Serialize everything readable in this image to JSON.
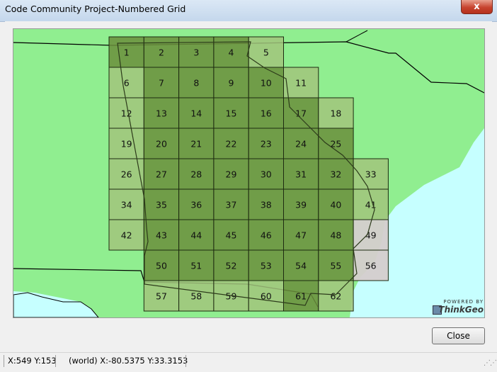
{
  "window": {
    "title": "Code Community Project-Numbered Grid",
    "close_glyph": "x"
  },
  "map": {
    "land_color": "#90ee90",
    "water_color": "#c6ffff",
    "cell_light_color": "#a2c47c",
    "cell_dark_color": "#6b8e3c",
    "cell_gray_color": "#d5cdcd",
    "grid_cells": [
      {
        "n": "1",
        "c": 0,
        "r": 0,
        "t": "dark"
      },
      {
        "n": "2",
        "c": 1,
        "r": 0,
        "t": "dark"
      },
      {
        "n": "3",
        "c": 2,
        "r": 0,
        "t": "dark"
      },
      {
        "n": "4",
        "c": 3,
        "r": 0,
        "t": "dark"
      },
      {
        "n": "5",
        "c": 4,
        "r": 0,
        "t": "light"
      },
      {
        "n": "6",
        "c": 0,
        "r": 1,
        "t": "light"
      },
      {
        "n": "7",
        "c": 1,
        "r": 1,
        "t": "dark"
      },
      {
        "n": "8",
        "c": 2,
        "r": 1,
        "t": "dark"
      },
      {
        "n": "9",
        "c": 3,
        "r": 1,
        "t": "dark"
      },
      {
        "n": "10",
        "c": 4,
        "r": 1,
        "t": "dark"
      },
      {
        "n": "11",
        "c": 5,
        "r": 1,
        "t": "light"
      },
      {
        "n": "12",
        "c": 0,
        "r": 2,
        "t": "light"
      },
      {
        "n": "13",
        "c": 1,
        "r": 2,
        "t": "dark"
      },
      {
        "n": "14",
        "c": 2,
        "r": 2,
        "t": "dark"
      },
      {
        "n": "15",
        "c": 3,
        "r": 2,
        "t": "dark"
      },
      {
        "n": "16",
        "c": 4,
        "r": 2,
        "t": "dark"
      },
      {
        "n": "17",
        "c": 5,
        "r": 2,
        "t": "dark"
      },
      {
        "n": "18",
        "c": 6,
        "r": 2,
        "t": "light"
      },
      {
        "n": "19",
        "c": 0,
        "r": 3,
        "t": "light"
      },
      {
        "n": "20",
        "c": 1,
        "r": 3,
        "t": "dark"
      },
      {
        "n": "21",
        "c": 2,
        "r": 3,
        "t": "dark"
      },
      {
        "n": "22",
        "c": 3,
        "r": 3,
        "t": "dark"
      },
      {
        "n": "23",
        "c": 4,
        "r": 3,
        "t": "dark"
      },
      {
        "n": "24",
        "c": 5,
        "r": 3,
        "t": "dark"
      },
      {
        "n": "25",
        "c": 6,
        "r": 3,
        "t": "dark"
      },
      {
        "n": "26",
        "c": 0,
        "r": 4,
        "t": "light"
      },
      {
        "n": "27",
        "c": 1,
        "r": 4,
        "t": "dark"
      },
      {
        "n": "28",
        "c": 2,
        "r": 4,
        "t": "dark"
      },
      {
        "n": "29",
        "c": 3,
        "r": 4,
        "t": "dark"
      },
      {
        "n": "30",
        "c": 4,
        "r": 4,
        "t": "dark"
      },
      {
        "n": "31",
        "c": 5,
        "r": 4,
        "t": "dark"
      },
      {
        "n": "32",
        "c": 6,
        "r": 4,
        "t": "dark"
      },
      {
        "n": "33",
        "c": 7,
        "r": 4,
        "t": "light"
      },
      {
        "n": "34",
        "c": 0,
        "r": 5,
        "t": "light"
      },
      {
        "n": "35",
        "c": 1,
        "r": 5,
        "t": "dark"
      },
      {
        "n": "36",
        "c": 2,
        "r": 5,
        "t": "dark"
      },
      {
        "n": "37",
        "c": 3,
        "r": 5,
        "t": "dark"
      },
      {
        "n": "38",
        "c": 4,
        "r": 5,
        "t": "dark"
      },
      {
        "n": "39",
        "c": 5,
        "r": 5,
        "t": "dark"
      },
      {
        "n": "40",
        "c": 6,
        "r": 5,
        "t": "dark"
      },
      {
        "n": "41",
        "c": 7,
        "r": 5,
        "t": "light"
      },
      {
        "n": "42",
        "c": 0,
        "r": 6,
        "t": "light"
      },
      {
        "n": "43",
        "c": 1,
        "r": 6,
        "t": "dark"
      },
      {
        "n": "44",
        "c": 2,
        "r": 6,
        "t": "dark"
      },
      {
        "n": "45",
        "c": 3,
        "r": 6,
        "t": "dark"
      },
      {
        "n": "46",
        "c": 4,
        "r": 6,
        "t": "dark"
      },
      {
        "n": "47",
        "c": 5,
        "r": 6,
        "t": "dark"
      },
      {
        "n": "48",
        "c": 6,
        "r": 6,
        "t": "dark"
      },
      {
        "n": "49",
        "c": 7,
        "r": 6,
        "t": "gray"
      },
      {
        "n": "50",
        "c": 1,
        "r": 7,
        "t": "dark"
      },
      {
        "n": "51",
        "c": 2,
        "r": 7,
        "t": "dark"
      },
      {
        "n": "52",
        "c": 3,
        "r": 7,
        "t": "dark"
      },
      {
        "n": "53",
        "c": 4,
        "r": 7,
        "t": "dark"
      },
      {
        "n": "54",
        "c": 5,
        "r": 7,
        "t": "dark"
      },
      {
        "n": "55",
        "c": 6,
        "r": 7,
        "t": "dark"
      },
      {
        "n": "56",
        "c": 7,
        "r": 7,
        "t": "gray"
      },
      {
        "n": "57",
        "c": 1,
        "r": 8,
        "t": "light"
      },
      {
        "n": "58",
        "c": 2,
        "r": 8,
        "t": "light"
      },
      {
        "n": "59",
        "c": 3,
        "r": 8,
        "t": "light"
      },
      {
        "n": "60",
        "c": 4,
        "r": 8,
        "t": "light"
      },
      {
        "n": "61",
        "c": 5,
        "r": 8,
        "t": "dark"
      },
      {
        "n": "62",
        "c": 6,
        "r": 8,
        "t": "light"
      }
    ],
    "badge_top": "POWERED BY",
    "badge_name": "ThinkGeo"
  },
  "buttons": {
    "close_label": "Close"
  },
  "status": {
    "screen_coords": "X:549 Y:153",
    "world_coords": "(world) X:-80.5375 Y:33.3153"
  }
}
